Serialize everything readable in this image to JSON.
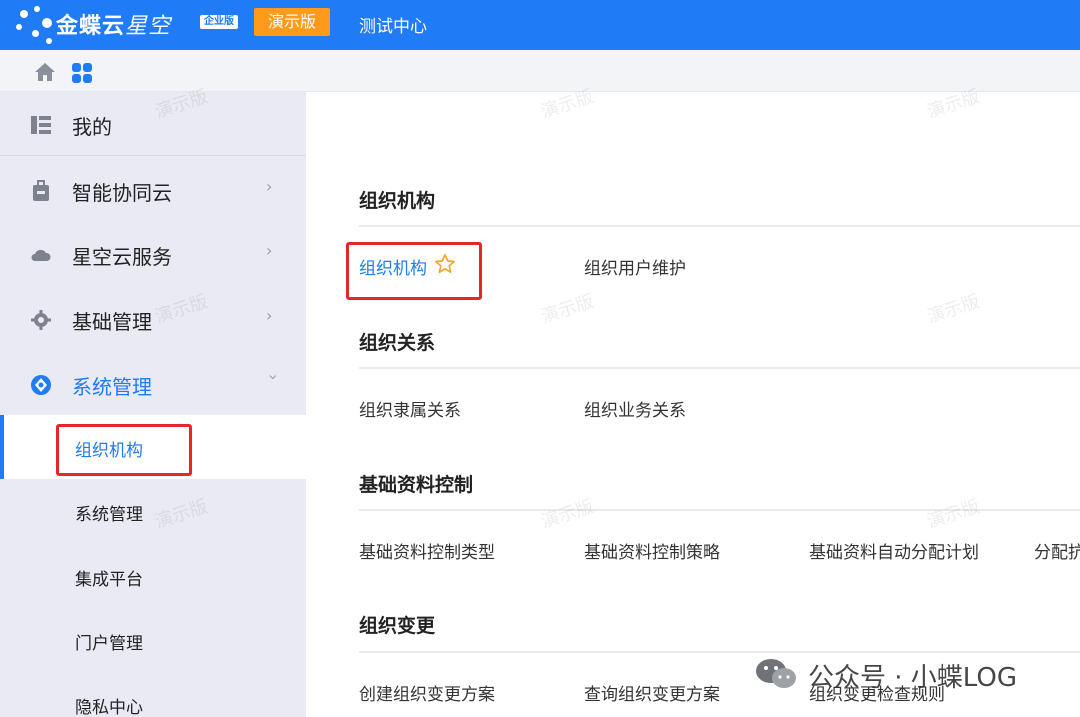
{
  "header": {
    "brand": "金蝶云",
    "brand_sub": "星空",
    "edition": "企业版",
    "demo_badge": "演示版",
    "center_title": "测试中心"
  },
  "toolbar": {
    "home_icon": "home-icon",
    "apps_icon": "apps-grid-icon"
  },
  "sidebar": {
    "items": [
      {
        "label": "我的",
        "icon": "list-icon"
      },
      {
        "label": "智能协同云",
        "icon": "briefcase-icon"
      },
      {
        "label": "星空云服务",
        "icon": "cloud-icon"
      },
      {
        "label": "基础管理",
        "icon": "gear-icon"
      },
      {
        "label": "系统管理",
        "icon": "system-icon"
      }
    ],
    "sub_items": [
      "组织机构",
      "系统管理",
      "集成平台",
      "门户管理",
      "隐私中心"
    ]
  },
  "main": {
    "sections": [
      {
        "title": "组织机构",
        "links": [
          "组织机构",
          "组织用户维护"
        ]
      },
      {
        "title": "组织关系",
        "links": [
          "组织隶属关系",
          "组织业务关系"
        ]
      },
      {
        "title": "基础资料控制",
        "links": [
          "基础资料控制类型",
          "基础资料控制策略",
          "基础资料自动分配计划",
          "分配抗"
        ]
      },
      {
        "title": "组织变更",
        "links": [
          "创建组织变更方案",
          "查询组织变更方案",
          "组织变更检查规则"
        ]
      }
    ]
  },
  "watermark": "演示版",
  "footer_badge": "公众号 · 小蝶LOG",
  "colors": {
    "primary": "#1f7bf6",
    "demo": "#ff9a1a",
    "highlight": "#e8262a",
    "sidebar_bg": "#e9eaf3"
  }
}
